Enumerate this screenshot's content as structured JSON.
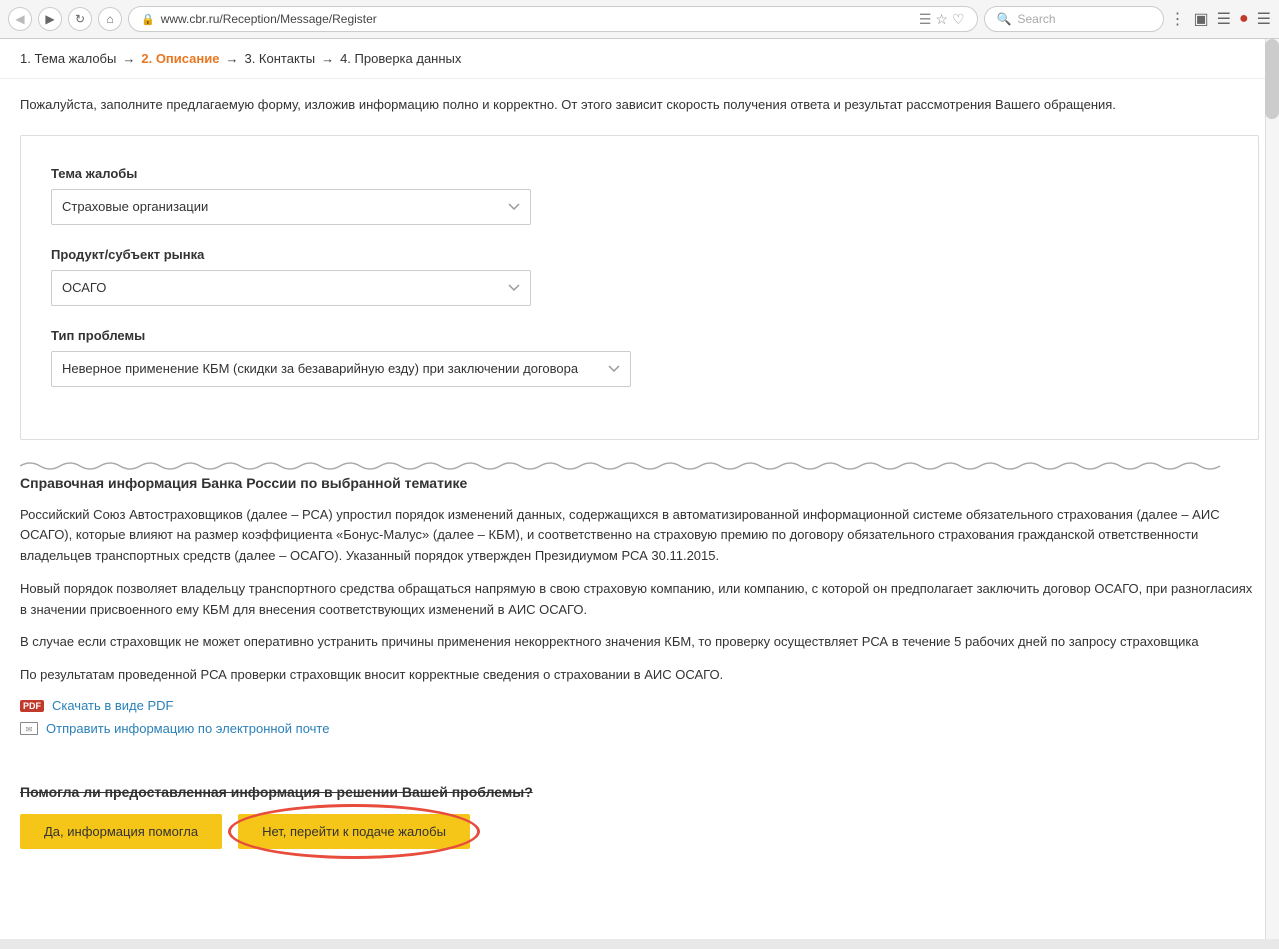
{
  "browser": {
    "url": "www.cbr.ru/Reception/Message/Register",
    "search_placeholder": "Search",
    "back_icon": "◀",
    "forward_icon": "▶",
    "reload_icon": "↻",
    "home_icon": "⌂"
  },
  "steps": {
    "step1": "1. Тема жалобы",
    "arrow1": "→",
    "step2": "2. Описание",
    "arrow2": "→",
    "step3": "3. Контакты",
    "arrow3": "→",
    "step4": "4. Проверка данных"
  },
  "intro": "Пожалуйста, заполните предлагаемую форму, изложив информацию полно и корректно. От этого зависит скорость получения ответа и результат рассмотрения Вашего обращения.",
  "form": {
    "field1_label": "Тема жалобы",
    "field1_value": "Страховые организации",
    "field2_label": "Продукт/субъект рынка",
    "field2_value": "ОСАГО",
    "field3_label": "Тип проблемы",
    "field3_value": "Неверное применение КБМ (скидки за безаварийную езду) при заключении договора"
  },
  "info": {
    "title": "Справочная информация Банка России по выбранной тематике",
    "paragraph1": "Российский Союз Автостраховщиков (далее – РСА) упростил порядок изменений данных, содержащихся в автоматизированной информационной системе обязательного страхования (далее – АИС ОСАГО), которые влияют на размер коэффициента «Бонус-Малус» (далее – КБМ), и соответственно на страховую премию по договору обязательного страхования гражданской ответственности владельцев транспортных средств (далее – ОСАГО). Указанный порядок утвержден Президиумом РСА 30.11.2015.",
    "paragraph2": "Новый порядок позволяет владельцу транспортного средства обращаться напрямую в свою страховую компанию, или компанию, с которой он предполагает заключить договор ОСАГО, при разногласиях в значении присвоенного ему КБМ для внесения соответствующих изменений в АИС ОСАГО.",
    "paragraph3": "В случае если страховщик не может оперативно устранить причины применения некорректного значения КБМ, то проверку осуществляет РСА в течение 5 рабочих дней по запросу страховщика",
    "paragraph4": "По результатам проведенной РСА проверки страховщик вносит корректные сведения о страховании в АИС ОСАГО.",
    "pdf_link": "Скачать в виде PDF",
    "email_link": "Отправить информацию по электронной почте"
  },
  "feedback": {
    "question": "Помогла ли предоставленная информация в решении Вашей проблемы?",
    "btn_yes": "Да, информация помогла",
    "btn_no": "Нет, перейти к подаче жалобы"
  }
}
